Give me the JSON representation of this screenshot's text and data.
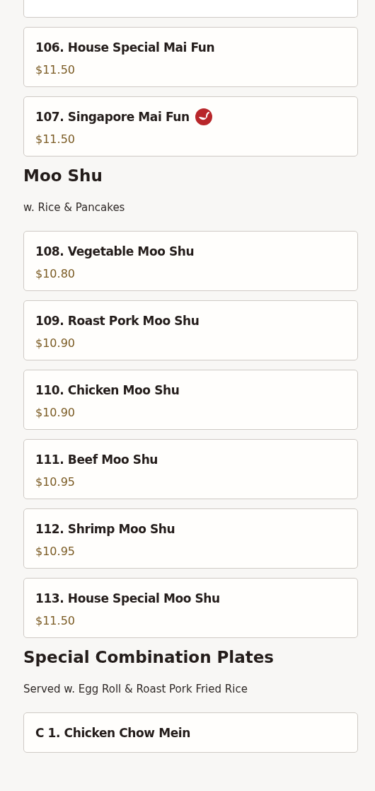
{
  "sections": [
    {
      "items": [
        {
          "name": "106. House Special Mai Fun",
          "price": "$11.50",
          "spicy": false
        },
        {
          "name": "107. Singapore Mai Fun",
          "price": "$11.50",
          "spicy": true
        }
      ]
    },
    {
      "title": "Moo Shu",
      "note": "w. Rice & Pancakes",
      "items": [
        {
          "name": "108. Vegetable Moo Shu",
          "price": "$10.80",
          "spicy": false
        },
        {
          "name": "109. Roast Pork Moo Shu",
          "price": "$10.90",
          "spicy": false
        },
        {
          "name": "110. Chicken Moo Shu",
          "price": "$10.90",
          "spicy": false
        },
        {
          "name": "111. Beef Moo Shu",
          "price": "$10.95",
          "spicy": false
        },
        {
          "name": "112. Shrimp Moo Shu",
          "price": "$10.95",
          "spicy": false
        },
        {
          "name": "113. House Special Moo Shu",
          "price": "$11.50",
          "spicy": false
        }
      ]
    },
    {
      "title": "Special Combination Plates",
      "note": "Served w. Egg Roll & Roast Pork Fried Rice",
      "items": [
        {
          "name": "C 1. Chicken Chow Mein"
        }
      ]
    }
  ]
}
